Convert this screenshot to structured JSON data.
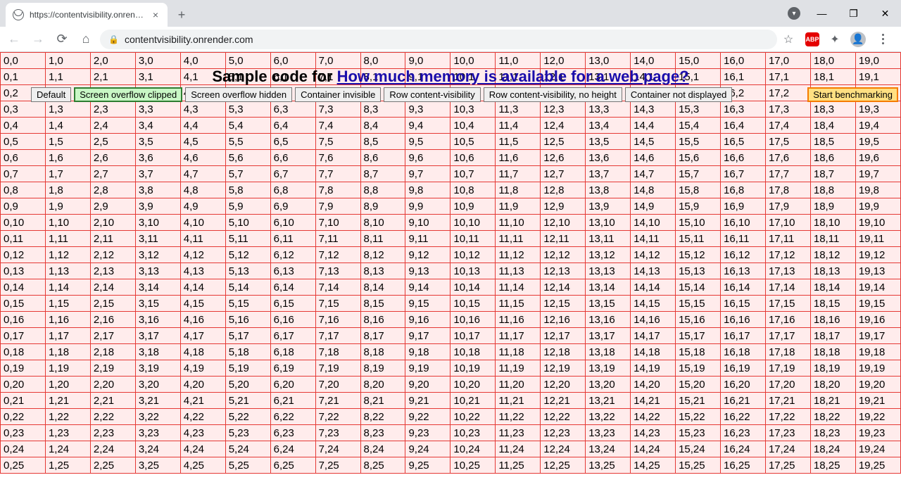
{
  "browser": {
    "tab_title": "https://contentvisibility.onrender",
    "url_display": "contentvisibility.onrender.com"
  },
  "page": {
    "heading_prefix": "Sample code for ",
    "heading_link": "How much memory is available for a web page?",
    "cols": 20,
    "rows": 26,
    "buttons": {
      "default": "Default",
      "overflow_clipped": "Screen overflow clipped",
      "overflow_hidden": "Screen overflow hidden",
      "container_invisible": "Container invisible",
      "row_cv": "Row content-visibility",
      "row_cv_nh": "Row content-visibility, no height",
      "container_nd": "Container not displayed",
      "start": "Start benchmarking"
    }
  }
}
